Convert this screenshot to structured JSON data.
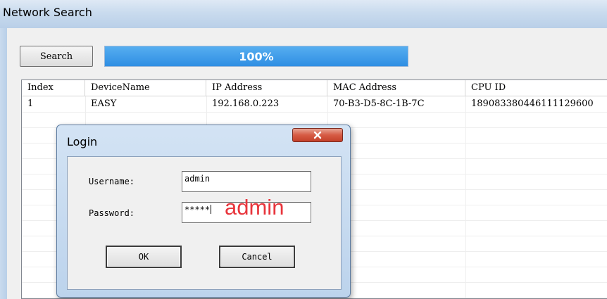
{
  "window": {
    "title": "Network Search"
  },
  "toolbar": {
    "search_label": "Search",
    "progress_text": "100%",
    "progress_value": 1.0
  },
  "table": {
    "columns": [
      "Index",
      "DeviceName",
      "IP Address",
      "MAC Address",
      "CPU ID"
    ],
    "rows": [
      [
        "1",
        "EASY",
        "192.168.0.223",
        "70-B3-D5-8C-1B-7C",
        "189083380446111129600"
      ]
    ]
  },
  "login_dialog": {
    "title": "Login",
    "close_glyph": "✕",
    "username_label": "Username:",
    "username_value": "admin",
    "password_label": "Password:",
    "password_value": "*****",
    "password_hint": "admin",
    "ok_label": "OK",
    "cancel_label": "Cancel"
  },
  "colors": {
    "progress_fill": "#2f8ee3",
    "annotation": "#e8353c",
    "close_button": "#d65b44"
  }
}
